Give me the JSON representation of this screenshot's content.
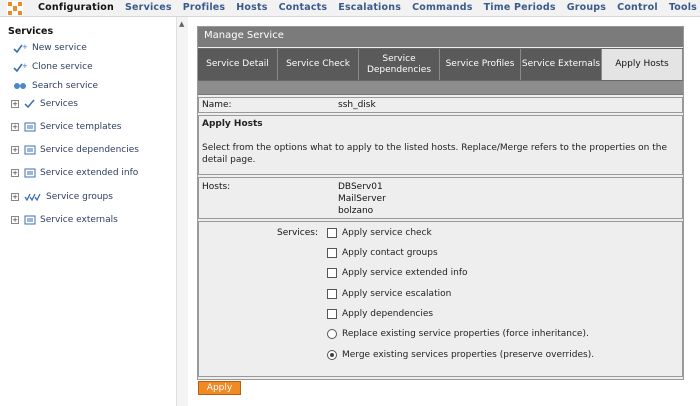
{
  "topnav": [
    {
      "label": "Configuration",
      "active": true
    },
    {
      "label": "Services"
    },
    {
      "label": "Profiles"
    },
    {
      "label": "Hosts"
    },
    {
      "label": "Contacts"
    },
    {
      "label": "Escalations"
    },
    {
      "label": "Commands"
    },
    {
      "label": "Time Periods"
    },
    {
      "label": "Groups"
    },
    {
      "label": "Control"
    },
    {
      "label": "Tools"
    }
  ],
  "sidebar": {
    "title": "Services",
    "links": [
      {
        "label": "New service",
        "icon": "new-service-icon"
      },
      {
        "label": "Clone service",
        "icon": "clone-service-icon"
      },
      {
        "label": "Search service",
        "icon": "search-icon"
      }
    ],
    "tree": [
      {
        "label": "Services",
        "icon": "services-icon"
      },
      {
        "label": "Service templates",
        "icon": "templates-icon"
      },
      {
        "label": "Service dependencies",
        "icon": "dependencies-icon"
      },
      {
        "label": "Service extended info",
        "icon": "extended-info-icon"
      },
      {
        "label": "Service groups",
        "icon": "groups-icon"
      },
      {
        "label": "Service externals",
        "icon": "externals-icon"
      }
    ]
  },
  "main": {
    "title": "Manage Service",
    "tabs": [
      {
        "label": "Service Detail"
      },
      {
        "label": "Service Check"
      },
      {
        "label": "Service Dependencies"
      },
      {
        "label": "Service Profiles"
      },
      {
        "label": "Service Externals"
      },
      {
        "label": "Apply Hosts",
        "active": true
      }
    ],
    "name_label": "Name:",
    "name_value": "ssh_disk",
    "apply_heading": "Apply Hosts",
    "apply_description": "Select from the options what to apply to the listed hosts. Replace/Merge refers to the properties on the detail page.",
    "hosts_label": "Hosts:",
    "hosts": [
      "DBServ01",
      "MailServer",
      "bolzano"
    ],
    "services_label": "Services:",
    "checkboxes": [
      {
        "label": "Apply service check",
        "checked": false
      },
      {
        "label": "Apply contact groups",
        "checked": false
      },
      {
        "label": "Apply service extended info",
        "checked": false
      },
      {
        "label": "Apply service escalation",
        "checked": false
      },
      {
        "label": "Apply dependencies",
        "checked": false
      }
    ],
    "radios": [
      {
        "label": "Replace existing service properties (force inheritance).",
        "selected": false
      },
      {
        "label": "Merge existing services properties (preserve overrides).",
        "selected": true
      }
    ],
    "apply_button": "Apply"
  },
  "colors": {
    "accent": "#f08a24",
    "tab_bg": "#5a5a5a",
    "header_bg": "#7b7b7b",
    "link": "#3a5a8c"
  }
}
